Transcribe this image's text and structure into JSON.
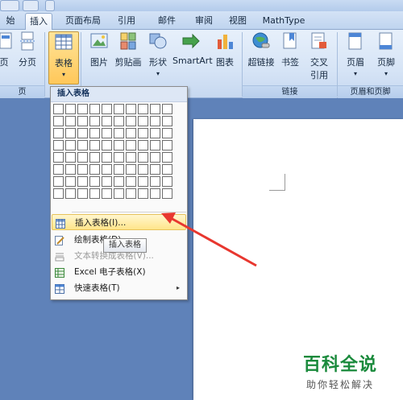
{
  "tabs": [
    {
      "label": "始"
    },
    {
      "label": "插入"
    },
    {
      "label": "页面布局"
    },
    {
      "label": "引用"
    },
    {
      "label": "邮件"
    },
    {
      "label": "审阅"
    },
    {
      "label": "视图"
    },
    {
      "label": "MathType"
    }
  ],
  "ribbon": {
    "pages": {
      "cover_label": "页",
      "break_label": "分页"
    },
    "table_btn": {
      "label": "表格",
      "arrow": "▾"
    },
    "illustrations": [
      {
        "label": "图片"
      },
      {
        "label": "剪贴画"
      },
      {
        "label": "形状",
        "arrow": "▾"
      },
      {
        "label": "SmartArt"
      },
      {
        "label": "图表"
      }
    ],
    "links": [
      {
        "label": "超链接"
      },
      {
        "label": "书签"
      },
      {
        "label": "交叉",
        "label2": "引用"
      }
    ],
    "header_footer": [
      {
        "label": "页眉",
        "arrow": "▾"
      },
      {
        "label": "页脚",
        "arrow": "▾"
      }
    ],
    "groups": {
      "pages": "页",
      "links": "链接",
      "header_footer": "页眉和页脚"
    }
  },
  "menu": {
    "header": "插入表格",
    "items": [
      {
        "label": "插入表格(I)..."
      },
      {
        "label": "绘制表格(D)"
      },
      {
        "label": "文本转换成表格(V)..."
      },
      {
        "label": "Excel 电子表格(X)"
      },
      {
        "label": "快速表格(T)",
        "arrow": "▸"
      }
    ]
  },
  "tooltip": "插入表格",
  "watermark": {
    "title": "百科全说",
    "subtitle": "助你轻松解决"
  },
  "colors": {
    "accent": "#ffc75a",
    "arrow": "#e8372f",
    "watermark": "#1a8a3c"
  }
}
